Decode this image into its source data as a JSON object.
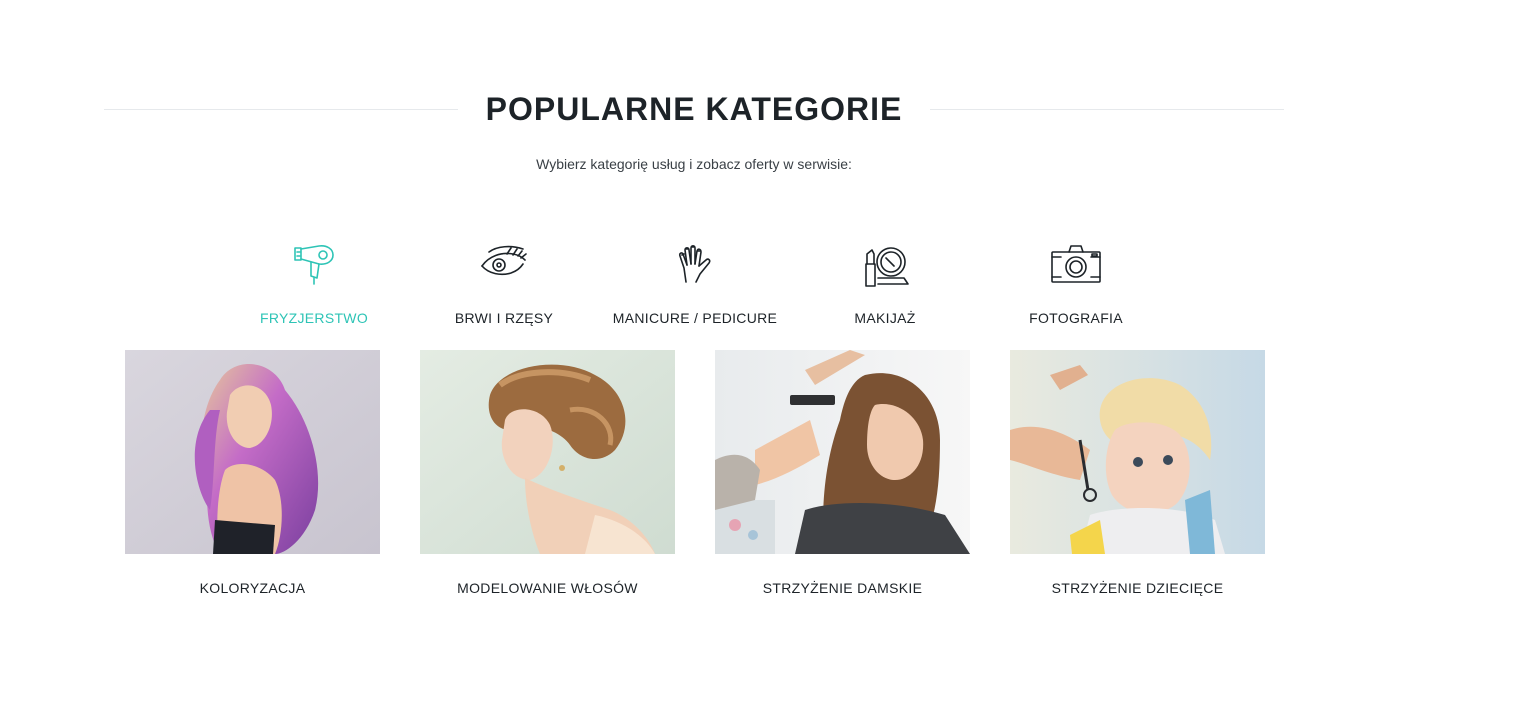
{
  "section": {
    "title": "POPULARNE KATEGORIE",
    "subtitle": "Wybierz kategorię usług i zobacz oferty w serwisie:"
  },
  "colors": {
    "accent": "#2ec4b6",
    "text": "#1d2328"
  },
  "categories": [
    {
      "label": "FRYZJERSTWO",
      "icon": "hair-dryer-icon",
      "active": true
    },
    {
      "label": "BRWI I RZĘSY",
      "icon": "eye-lashes-icon",
      "active": false
    },
    {
      "label": "MANICURE / PEDICURE",
      "icon": "hand-nails-icon",
      "active": false
    },
    {
      "label": "MAKIJAŻ",
      "icon": "makeup-mirror-icon",
      "active": false
    },
    {
      "label": "FOTOGRAFIA",
      "icon": "camera-icon",
      "active": false
    }
  ],
  "cards": [
    {
      "label": "KOLORYZACJA",
      "image": "woman-with-purple-dyed-hair"
    },
    {
      "label": "MODELOWANIE WŁOSÓW",
      "image": "woman-with-braided-updo"
    },
    {
      "label": "STRZYŻENIE DAMSKIE",
      "image": "woman-getting-haircut"
    },
    {
      "label": "STRZYŻENIE DZIECIĘCE",
      "image": "toddler-getting-haircut"
    }
  ]
}
